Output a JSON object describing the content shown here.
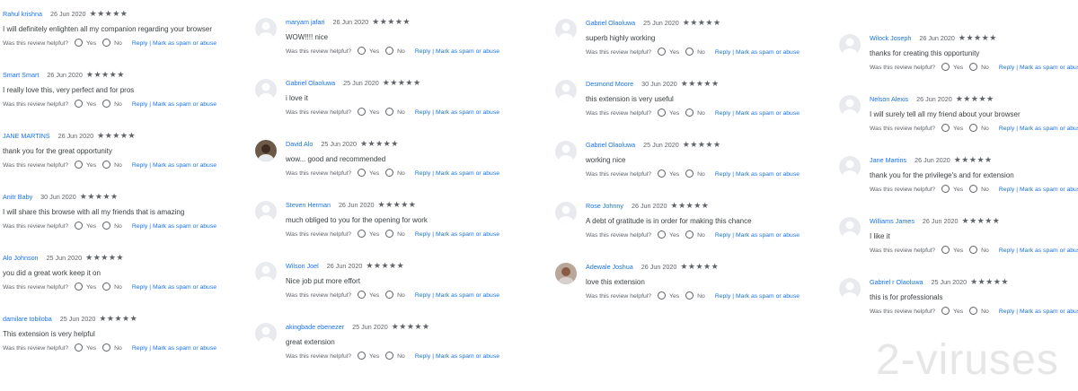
{
  "ui": {
    "helpful_label": "Was this review helpful?",
    "yes": "Yes",
    "no": "No",
    "reply": "Reply",
    "separator": "|",
    "spam": "Mark as spam or abuse",
    "stars": "★★★★★"
  },
  "watermark": "2-viruses",
  "columns": [
    {
      "reviews": [
        {
          "author": "Rahul krishna",
          "date": "26 Jun 2020",
          "text": "I will definitely enlighten all my companion regarding your browser",
          "avatar": "none"
        },
        {
          "author": "Smart Smart",
          "date": "26 Jun 2020",
          "text": "I really love this, very perfect and for pros",
          "avatar": "none"
        },
        {
          "author": "JANE MARTINS",
          "date": "26 Jun 2020",
          "text": "thank you for the great opportunity",
          "avatar": "none"
        },
        {
          "author": "Anitr Baby",
          "date": "30 Jun 2020",
          "text": "I will share this browse with all my friends that is amazing",
          "avatar": "none"
        },
        {
          "author": "Alo Johnson",
          "date": "25 Jun 2020",
          "text": "you did a great work keep it on",
          "avatar": "none"
        },
        {
          "author": "damilare tobiloba",
          "date": "25 Jun 2020",
          "text": "This extension is very helpful",
          "avatar": "none"
        }
      ]
    },
    {
      "reviews": [
        {
          "author": "maryam jafari",
          "date": "26 Jun 2020",
          "text": "WOW!!!! nice",
          "avatar": "default"
        },
        {
          "author": "Gabriel Olaoluwa",
          "date": "25 Jun 2020",
          "text": "i love it",
          "avatar": "default"
        },
        {
          "author": "David Alo",
          "date": "25 Jun 2020",
          "text": "wow... good and recommended",
          "avatar": "photo"
        },
        {
          "author": "Steven Herman",
          "date": "26 Jun 2020",
          "text": "much obliged to you for the opening for work",
          "avatar": "default"
        },
        {
          "author": "Wilson Joel",
          "date": "26 Jun 2020",
          "text": "Nice job put more effort",
          "avatar": "default"
        },
        {
          "author": "akingbade ebenezer",
          "date": "25 Jun 2020",
          "text": "great extension",
          "avatar": "default"
        }
      ]
    },
    {
      "reviews": [
        {
          "author": "Gabriel Olaoluwa",
          "date": "25 Jun 2020",
          "text": "superb highly working",
          "avatar": "default"
        },
        {
          "author": "Desmond Moore",
          "date": "30 Jun 2020",
          "text": "this extension is very useful",
          "avatar": "default"
        },
        {
          "author": "Gabriel Olaoluwa",
          "date": "25 Jun 2020",
          "text": "working nice",
          "avatar": "default"
        },
        {
          "author": "Rose Johnny",
          "date": "26 Jun 2020",
          "text": "A debt of gratitude is in order for making this chance",
          "avatar": "default"
        },
        {
          "author": "Adewale Joshua",
          "date": "26 Jun 2020",
          "text": "love this extension",
          "avatar": "photo"
        }
      ]
    },
    {
      "reviews": [
        {
          "author": "Wilock Joseph",
          "date": "26 Jun 2020",
          "text": "thanks for creating this opportunity",
          "avatar": "default"
        },
        {
          "author": "Nelson Alexis",
          "date": "26 Jun 2020",
          "text": "I will surely tell all my friend about your browser",
          "avatar": "default"
        },
        {
          "author": "Jane Martins",
          "date": "26 Jun 2020",
          "text": "thank you for the privilege's and for extension",
          "avatar": "default"
        },
        {
          "author": "Williams James",
          "date": "26 Jun 2020",
          "text": "I like it",
          "avatar": "default"
        },
        {
          "author": "Gabriel r Olaoluwa",
          "date": "25 Jun 2020",
          "text": "this is for professionals",
          "avatar": "default"
        }
      ]
    }
  ]
}
